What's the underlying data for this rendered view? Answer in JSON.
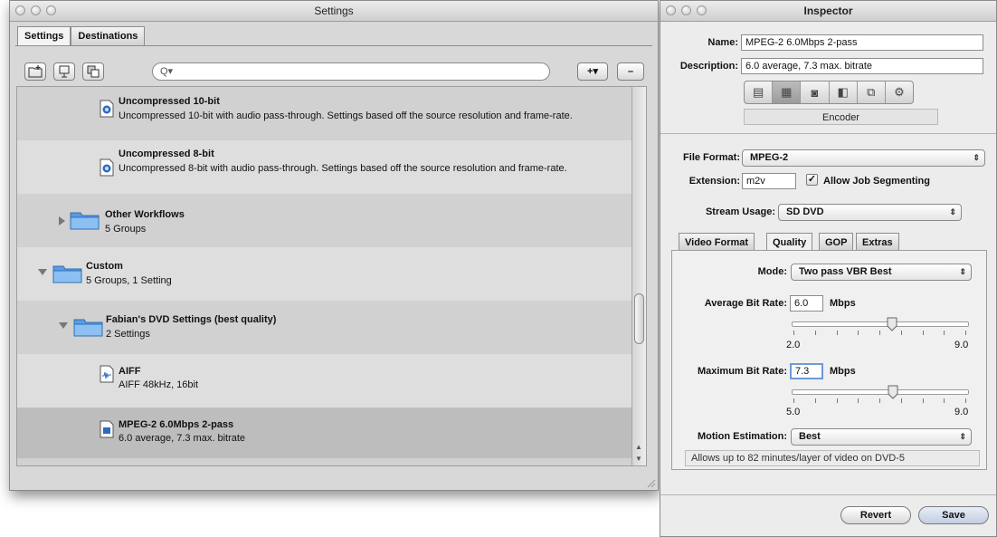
{
  "settings_window": {
    "title": "Settings",
    "tabs": [
      "Settings",
      "Destinations"
    ],
    "search_placeholder": "Q▾",
    "add_menu_label": "+▾",
    "remove_label": "–",
    "rows": [
      {
        "kind": "setting",
        "title": "Uncompressed 10-bit",
        "subtitle": "Uncompressed 10-bit with audio pass-through. Settings based off the source resolution and frame-rate.",
        "icon": "quicktime-document-icon"
      },
      {
        "kind": "setting",
        "title": "Uncompressed 8-bit",
        "subtitle": "Uncompressed 8-bit with audio pass-through. Settings based off the source resolution and frame-rate.",
        "icon": "quicktime-document-icon"
      },
      {
        "kind": "group",
        "title": "Other Workflows",
        "subtitle": "5 Groups",
        "expanded": false
      },
      {
        "kind": "group",
        "title": "Custom",
        "subtitle": "5 Groups, 1 Setting",
        "expanded": true
      },
      {
        "kind": "group",
        "title": "Fabian's DVD Settings (best quality)",
        "subtitle": "2 Settings",
        "expanded": true
      },
      {
        "kind": "setting",
        "title": "AIFF",
        "subtitle": "AIFF 48kHz, 16bit",
        "icon": "audio-document-icon"
      },
      {
        "kind": "setting",
        "title": "MPEG-2 6.0Mbps 2-pass",
        "subtitle": "6.0 average, 7.3 max. bitrate",
        "icon": "mpeg-document-icon",
        "selected": true
      }
    ]
  },
  "inspector": {
    "title": "Inspector",
    "name_label": "Name:",
    "name_value": "MPEG-2 6.0Mbps 2-pass",
    "description_label": "Description:",
    "description_value": "6.0 average, 7.3 max. bitrate",
    "encoder_label": "Encoder",
    "file_format_label": "File Format:",
    "file_format_value": "MPEG-2",
    "extension_label": "Extension:",
    "extension_value": "m2v",
    "allow_segmenting_label": "Allow Job Segmenting",
    "allow_segmenting_checked": true,
    "stream_usage_label": "Stream Usage:",
    "stream_usage_value": "SD DVD",
    "tabs": [
      "Video Format",
      "Quality",
      "GOP",
      "Extras"
    ],
    "active_tab": "Quality",
    "mode_label": "Mode:",
    "mode_value": "Two pass VBR Best",
    "avg_label": "Average Bit Rate:",
    "avg_value": "6.0",
    "avg_unit": "Mbps",
    "avg_min": "2.0",
    "avg_max": "9.0",
    "max_label": "Maximum Bit Rate:",
    "max_value": "7.3",
    "max_unit": "Mbps",
    "max_min": "5.0",
    "max_max": "9.0",
    "motion_label": "Motion Estimation:",
    "motion_value": "Best",
    "info_message": "Allows up to 82 minutes/layer of video on DVD-5",
    "revert_label": "Revert",
    "save_label": "Save"
  }
}
